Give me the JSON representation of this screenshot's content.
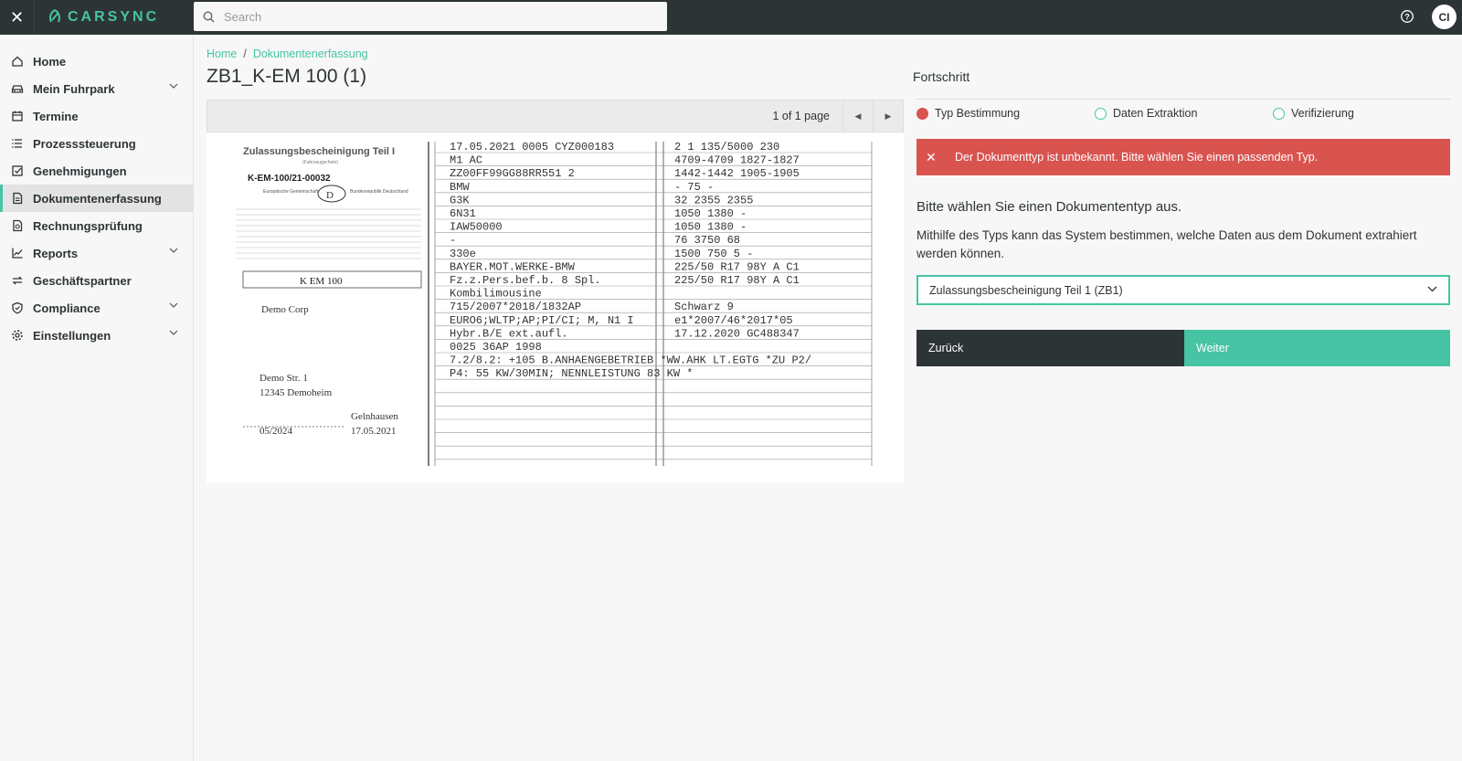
{
  "topbar": {
    "logo_text": "CARSYNC",
    "search_placeholder": "Search",
    "avatar_initials": "CI",
    "brand_color": "#46c4a4"
  },
  "sidebar": {
    "items": [
      {
        "label": "Home",
        "icon": "home-icon",
        "expandable": false,
        "active": false
      },
      {
        "label": "Mein Fuhrpark",
        "icon": "car-icon",
        "expandable": true,
        "active": false
      },
      {
        "label": "Termine",
        "icon": "calendar-icon",
        "expandable": false,
        "active": false
      },
      {
        "label": "Prozesssteuerung",
        "icon": "list-icon",
        "expandable": false,
        "active": false
      },
      {
        "label": "Genehmigungen",
        "icon": "checkbox-icon",
        "expandable": false,
        "active": false
      },
      {
        "label": "Dokumentenerfassung",
        "icon": "document-icon",
        "expandable": false,
        "active": true
      },
      {
        "label": "Rechnungsprüfung",
        "icon": "invoice-icon",
        "expandable": false,
        "active": false
      },
      {
        "label": "Reports",
        "icon": "chart-icon",
        "expandable": true,
        "active": false
      },
      {
        "label": "Geschäftspartner",
        "icon": "swap-icon",
        "expandable": false,
        "active": false
      },
      {
        "label": "Compliance",
        "icon": "shield-icon",
        "expandable": true,
        "active": false
      },
      {
        "label": "Einstellungen",
        "icon": "gear-icon",
        "expandable": true,
        "active": false
      }
    ]
  },
  "breadcrumb": {
    "home": "Home",
    "separator": "/",
    "current": "Dokumentenerfassung"
  },
  "page_title": "ZB1_K-EM 100 (1)",
  "viewer": {
    "page_info": "1 of 1 page",
    "doc": {
      "title": "Zulassungsbescheinigung Teil I",
      "subtitle": "(Fahrzeugschein)",
      "doc_number": "K-EM-100/21-00032",
      "country_left": "Europäische Gemeinschaft",
      "country_code": "D",
      "country_right": "Bundesrepublik Deutschland",
      "plate": "K EM 100",
      "owner": "Demo Corp",
      "street": "Demo Str. 1",
      "city": "12345 Demoheim",
      "date_left": "05/2024",
      "place": "Gelnhausen",
      "date_right": "17.05.2021",
      "rows": [
        "17.05.2021 0005 CYZ000183 | 2  1  135/5000  230",
        "M1   AC | 4709-4709  1827-1827",
        "ZZ00FF99GG88RR551  2 | 1442-1442  1905-1905",
        "BMW | -  75  -",
        "G3K | 32  2355  2355",
        "6N31 | 1050  1380  -",
        "IAW50000 | 1050  1380  -",
        "- | 76  3750  68",
        "330e | 1500  750  5  -",
        "BAYER.MOT.WERKE-BMW | 225/50 R17 98Y A C1",
        "Fz.z.Pers.bef.b. 8 Spl. | 225/50 R17 98Y A C1",
        "Kombilimousine",
        "715/2007*2018/1832AP | Schwarz  9",
        "EURO6;WLTP;AP;PI/CI; M, N1 I | e1*2007/46*2017*05",
        "Hybr.B/E ext.aufl. | 17.12.2020  GC488347",
        "0025  36AP  1998",
        "7.2/8.2: +105 B.ANHAENGEBETRIEB *WW.AHK LT.EGTG *ZU P2/",
        "P4: 55 KW/30MIN; NENNLEISTUNG 83 KW *"
      ]
    }
  },
  "progress": {
    "title": "Fortschritt",
    "steps": [
      {
        "label": "Typ Bestimmung",
        "state": "error"
      },
      {
        "label": "Daten Extraktion",
        "state": "pending"
      },
      {
        "label": "Verifizierung",
        "state": "pending"
      }
    ]
  },
  "alert": {
    "text": "Der Dokumenttyp ist unbekannt. Bitte wählen Sie einen passenden Typ.",
    "color": "#d9534f"
  },
  "form": {
    "heading": "Bitte wählen Sie einen Dokumententyp aus.",
    "description": "Mithilfe des Typs kann das System bestimmen, welche Daten aus dem Dokument extrahiert werden können.",
    "selected_type": "Zulassungsbescheinigung Teil 1 (ZB1)",
    "back_label": "Zurück",
    "next_label": "Weiter"
  }
}
